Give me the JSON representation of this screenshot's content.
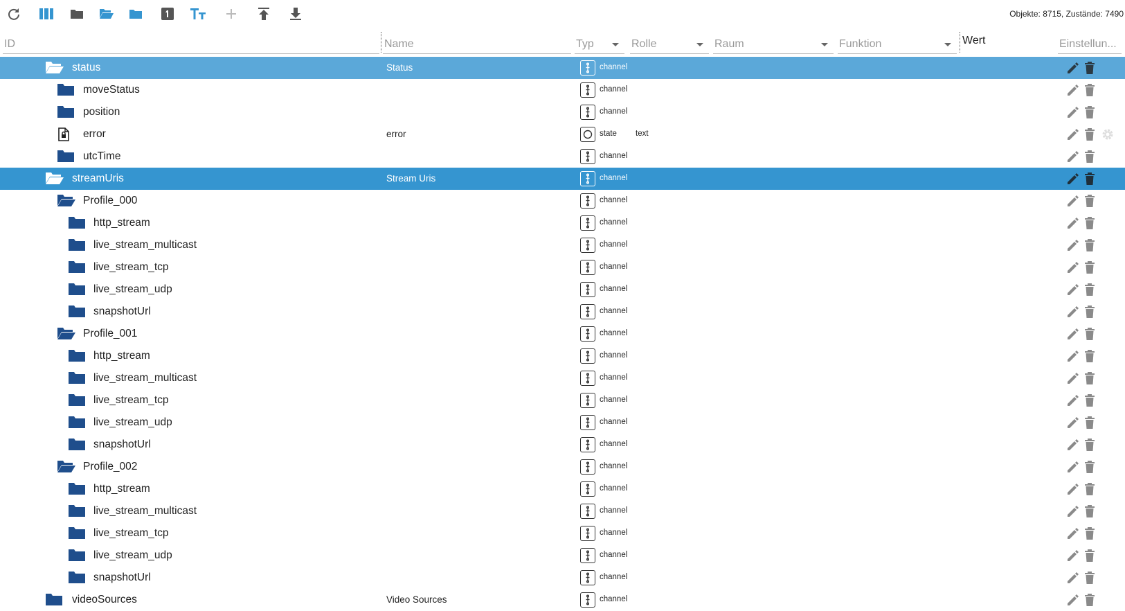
{
  "toolbar": {
    "icons": [
      "refresh-icon",
      "columns-icon",
      "folder-icon",
      "folder-open-icon",
      "folder-icon",
      "number-1-icon",
      "text-size-icon",
      "plus-icon",
      "upload-icon",
      "download-icon"
    ],
    "colors": {
      "accent": "#3595d0",
      "gray": "#555555",
      "disabled": "#bbbbbb"
    },
    "counts": "Objekte: 8715, Zustände: 7490"
  },
  "header": {
    "id_placeholder": "ID",
    "name_placeholder": "Name",
    "typ_label": "Typ",
    "rolle_label": "Rolle",
    "raum_label": "Raum",
    "funktion_label": "Funktion",
    "wert_label": "Wert",
    "settings_label": "Einstellun..."
  },
  "colors": {
    "folder": "#1f4e8c",
    "row_selected_light": "#5ba8d9",
    "row_selected": "#3595d0",
    "action_icon": "#8a8a8a"
  },
  "rows": [
    {
      "id": "status",
      "name": "Status",
      "type": "channel",
      "role": "",
      "icon": "folder-open-icon",
      "selected": "light"
    },
    {
      "id": "moveStatus",
      "name": "",
      "type": "channel",
      "role": "",
      "icon": "folder-icon"
    },
    {
      "id": "position",
      "name": "",
      "type": "channel",
      "role": "",
      "icon": "folder-icon"
    },
    {
      "id": "error",
      "name": "error",
      "type": "state",
      "role": "text",
      "icon": "file-lock-icon",
      "settings": true
    },
    {
      "id": "utcTime",
      "name": "",
      "type": "channel",
      "role": "",
      "icon": "folder-icon"
    },
    {
      "id": "streamUris",
      "name": "Stream Uris",
      "type": "channel",
      "role": "",
      "icon": "folder-open-icon",
      "selected": "dark"
    },
    {
      "id": "Profile_000",
      "name": "",
      "type": "channel",
      "role": "",
      "icon": "folder-open-icon"
    },
    {
      "id": "http_stream",
      "name": "",
      "type": "channel",
      "role": "",
      "icon": "folder-icon"
    },
    {
      "id": "live_stream_multicast",
      "name": "",
      "type": "channel",
      "role": "",
      "icon": "folder-icon"
    },
    {
      "id": "live_stream_tcp",
      "name": "",
      "type": "channel",
      "role": "",
      "icon": "folder-icon"
    },
    {
      "id": "live_stream_udp",
      "name": "",
      "type": "channel",
      "role": "",
      "icon": "folder-icon"
    },
    {
      "id": "snapshotUrl",
      "name": "",
      "type": "channel",
      "role": "",
      "icon": "folder-icon"
    },
    {
      "id": "Profile_001",
      "name": "",
      "type": "channel",
      "role": "",
      "icon": "folder-open-icon"
    },
    {
      "id": "http_stream",
      "name": "",
      "type": "channel",
      "role": "",
      "icon": "folder-icon"
    },
    {
      "id": "live_stream_multicast",
      "name": "",
      "type": "channel",
      "role": "",
      "icon": "folder-icon"
    },
    {
      "id": "live_stream_tcp",
      "name": "",
      "type": "channel",
      "role": "",
      "icon": "folder-icon"
    },
    {
      "id": "live_stream_udp",
      "name": "",
      "type": "channel",
      "role": "",
      "icon": "folder-icon"
    },
    {
      "id": "snapshotUrl",
      "name": "",
      "type": "channel",
      "role": "",
      "icon": "folder-icon"
    },
    {
      "id": "Profile_002",
      "name": "",
      "type": "channel",
      "role": "",
      "icon": "folder-open-icon"
    },
    {
      "id": "http_stream",
      "name": "",
      "type": "channel",
      "role": "",
      "icon": "folder-icon"
    },
    {
      "id": "live_stream_multicast",
      "name": "",
      "type": "channel",
      "role": "",
      "icon": "folder-icon"
    },
    {
      "id": "live_stream_tcp",
      "name": "",
      "type": "channel",
      "role": "",
      "icon": "folder-icon"
    },
    {
      "id": "live_stream_udp",
      "name": "",
      "type": "channel",
      "role": "",
      "icon": "folder-icon"
    },
    {
      "id": "snapshotUrl",
      "name": "",
      "type": "channel",
      "role": "",
      "icon": "folder-icon"
    },
    {
      "id": "videoSources",
      "name": "Video Sources",
      "type": "channel",
      "role": "",
      "icon": "folder-icon"
    }
  ]
}
